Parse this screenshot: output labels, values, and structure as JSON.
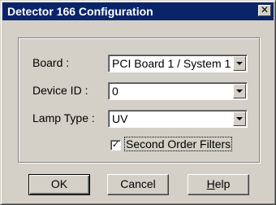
{
  "window": {
    "title": "Detector 166 Configuration",
    "close_glyph": "✕"
  },
  "form": {
    "board": {
      "label": "Board :",
      "value": "PCI Board 1 / System 1"
    },
    "device_id": {
      "label": "Device ID :",
      "value": "0"
    },
    "lamp_type": {
      "label": "Lamp Type :",
      "value": "UV"
    },
    "second_order": {
      "label": "Second Order Filters",
      "checked": true,
      "mark": "✓"
    }
  },
  "buttons": {
    "ok": "OK",
    "cancel": "Cancel",
    "help": "Help"
  },
  "colors": {
    "titlebar": "#0a246a",
    "face": "#d4d0c8"
  }
}
